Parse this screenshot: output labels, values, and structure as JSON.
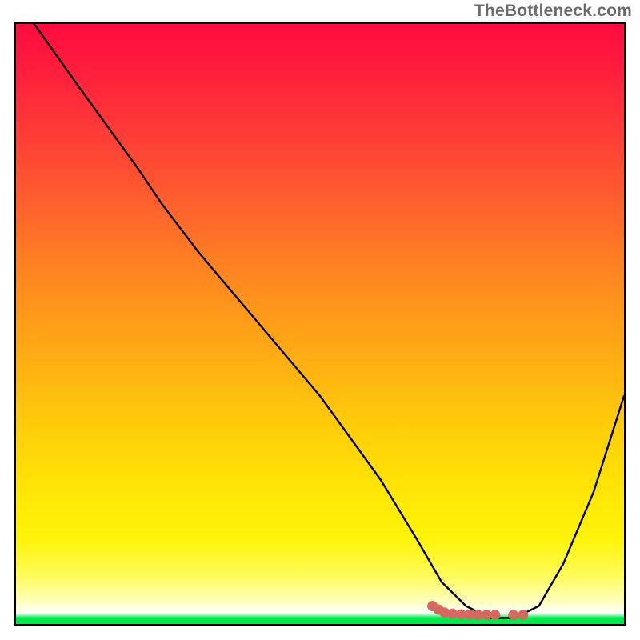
{
  "watermark": "TheBottleneck.com",
  "chart_data": {
    "type": "line",
    "title": "",
    "xlabel": "",
    "ylabel": "",
    "xlim": [
      0,
      100
    ],
    "ylim": [
      0,
      100
    ],
    "series": [
      {
        "name": "bottleneck-curve",
        "x": [
          3,
          10,
          20,
          24,
          30,
          40,
          50,
          60,
          66,
          70,
          74,
          78,
          82,
          86,
          90,
          95,
          100
        ],
        "y": [
          100,
          90,
          76,
          70,
          62,
          50,
          38,
          24,
          14,
          7,
          3,
          1,
          1,
          3,
          10,
          22,
          38
        ]
      }
    ],
    "marker_cluster": {
      "name": "valley-markers",
      "color": "#d46a5f",
      "points": [
        {
          "x": 68.5,
          "y": 3.0
        },
        {
          "x": 69.5,
          "y": 2.4
        },
        {
          "x": 70.5,
          "y": 1.9
        },
        {
          "x": 71.8,
          "y": 1.7
        },
        {
          "x": 73.2,
          "y": 1.6
        },
        {
          "x": 74.6,
          "y": 1.55
        },
        {
          "x": 76.0,
          "y": 1.5
        },
        {
          "x": 77.4,
          "y": 1.5
        },
        {
          "x": 78.8,
          "y": 1.5
        },
        {
          "x": 81.8,
          "y": 1.5
        },
        {
          "x": 83.4,
          "y": 1.5
        }
      ]
    },
    "background_gradient": {
      "stops": [
        {
          "pos": 0.0,
          "color": "#ff0b3e"
        },
        {
          "pos": 0.5,
          "color": "#ff981a"
        },
        {
          "pos": 0.85,
          "color": "#fff40a"
        },
        {
          "pos": 0.985,
          "color": "#ffffff"
        },
        {
          "pos": 1.0,
          "color": "#00e84a"
        }
      ]
    }
  }
}
